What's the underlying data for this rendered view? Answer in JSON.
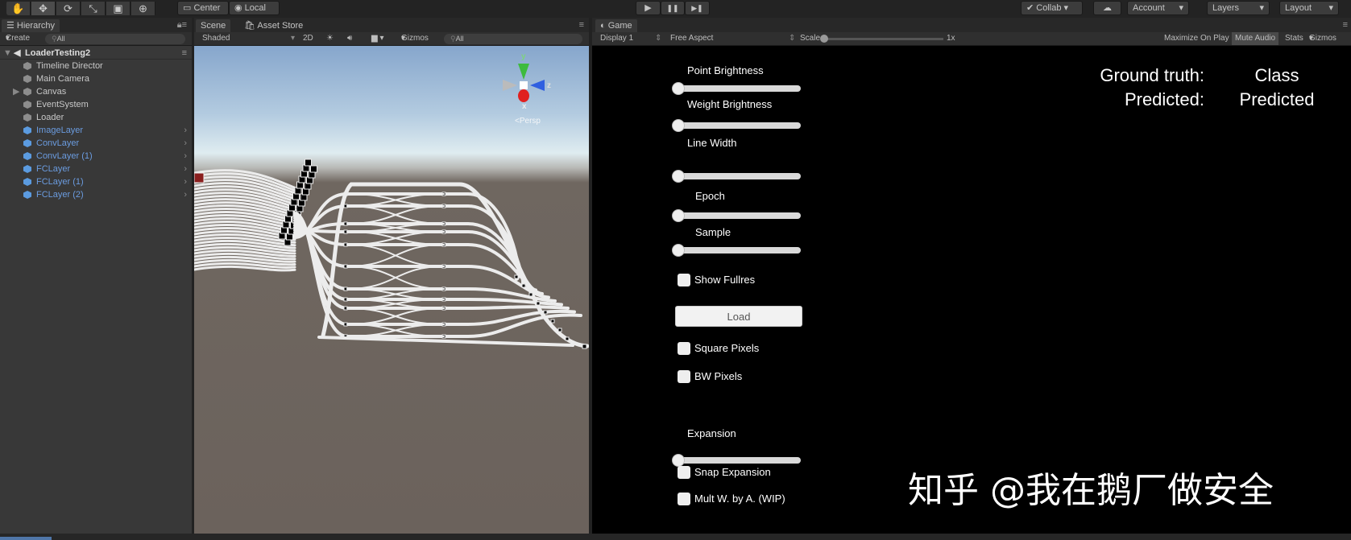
{
  "toolbar": {
    "tools": [
      {
        "icon": "hand-icon",
        "glyph": "✋"
      },
      {
        "icon": "move-icon",
        "glyph": "✥"
      },
      {
        "icon": "rotate-icon",
        "glyph": "⟳"
      },
      {
        "icon": "scale-icon",
        "glyph": "⤡"
      },
      {
        "icon": "rect-icon",
        "glyph": "▣"
      },
      {
        "icon": "transform-icon",
        "glyph": "⊕"
      }
    ],
    "pivot": "Center",
    "space": "Local",
    "play": "▶",
    "pause": "❚❚",
    "step": "▶❚",
    "collab": "Collab",
    "account": "Account",
    "layers": "Layers",
    "layout": "Layout"
  },
  "hierarchy": {
    "tab": "Hierarchy",
    "create": "Create",
    "search_placeholder": "All",
    "scene": "LoaderTesting2",
    "items": [
      {
        "label": "Timeline Director",
        "prefab": false
      },
      {
        "label": "Main Camera",
        "prefab": false
      },
      {
        "label": "Canvas",
        "prefab": false,
        "expandable": true
      },
      {
        "label": "EventSystem",
        "prefab": false
      },
      {
        "label": "Loader",
        "prefab": false
      },
      {
        "label": "ImageLayer",
        "prefab": true
      },
      {
        "label": "ConvLayer",
        "prefab": true
      },
      {
        "label": "ConvLayer (1)",
        "prefab": true
      },
      {
        "label": "FCLayer",
        "prefab": true
      },
      {
        "label": "FCLayer (1)",
        "prefab": true
      },
      {
        "label": "FCLayer (2)",
        "prefab": true
      }
    ]
  },
  "scene": {
    "tab": "Scene",
    "asset_store_tab": "Asset Store",
    "shading": "Shaded",
    "mode_2d": "2D",
    "gizmos": "Gizmos",
    "search_placeholder": "All",
    "persp": "Persp",
    "axis_y": "y",
    "axis_z": "z",
    "axis_x": "x"
  },
  "game": {
    "tab": "Game",
    "display": "Display 1",
    "aspect": "Free Aspect",
    "scale_label": "Scale",
    "scale_value": "1x",
    "maximize": "Maximize On Play",
    "mute": "Mute Audio",
    "stats": "Stats",
    "gizmos": "Gizmos",
    "sliders": [
      {
        "label": "Point Brightness",
        "value": 0
      },
      {
        "label": "Weight Brightness",
        "value": 0
      },
      {
        "label": "Line Width",
        "value": 0
      },
      {
        "label": "Epoch",
        "value": 0
      },
      {
        "label": "Sample",
        "value": 0
      },
      {
        "label": "Expansion",
        "value": 0
      }
    ],
    "checkboxes": [
      {
        "label": "Show Fullres",
        "checked": false
      },
      {
        "label": "Square Pixels",
        "checked": false
      },
      {
        "label": "BW Pixels",
        "checked": false
      },
      {
        "label": "Snap Expansion",
        "checked": false
      },
      {
        "label": "Mult W. by A. (WIP)",
        "checked": false
      }
    ],
    "load_button": "Load",
    "ground_truth_label": "Ground truth:",
    "ground_truth_value": "Class",
    "predicted_label": "Predicted:",
    "predicted_value": "Predicted",
    "watermark": "知乎 @我在鹅厂做安全"
  }
}
